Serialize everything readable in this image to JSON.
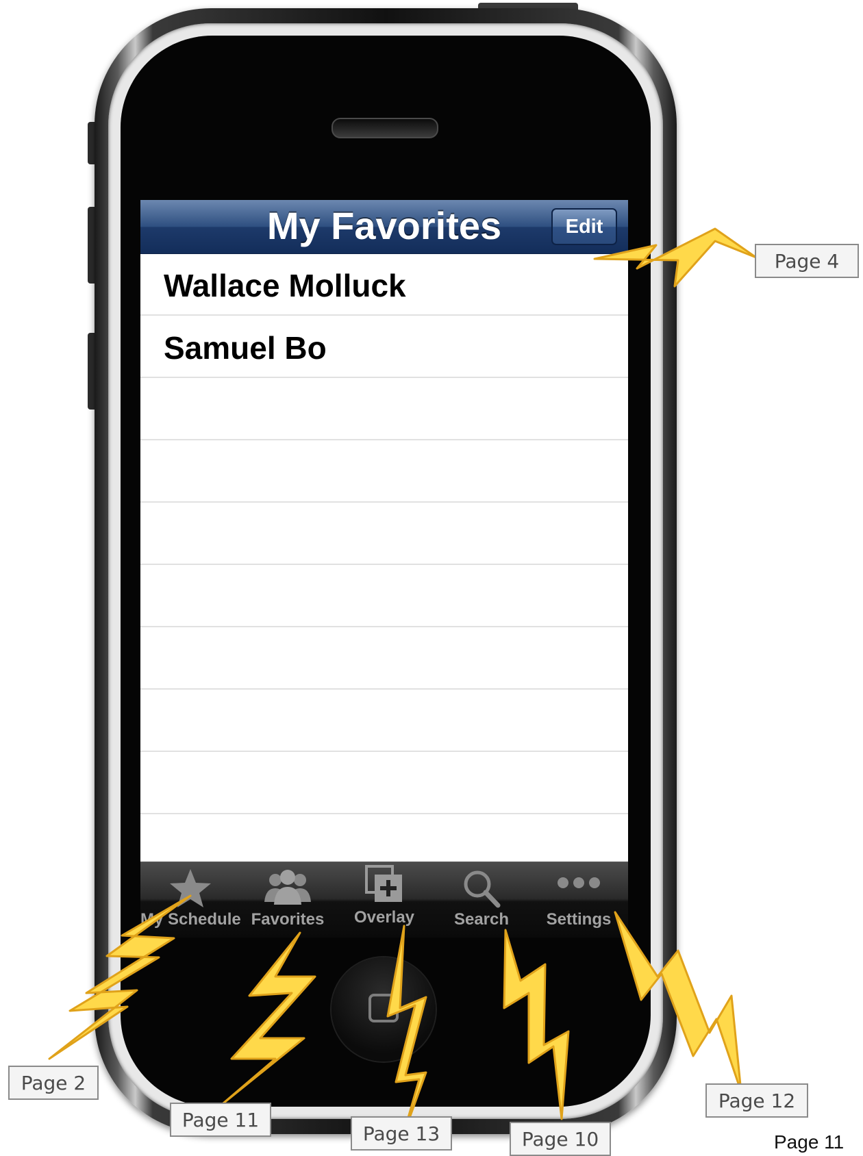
{
  "screen": {
    "title": "My Favorites",
    "edit_label": "Edit",
    "favorites": [
      "Wallace Molluck",
      "Samuel Bo"
    ]
  },
  "tab_bar": {
    "tabs": [
      {
        "label": "My Schedule",
        "icon": "star-icon"
      },
      {
        "label": "Favorites",
        "icon": "people-icon"
      },
      {
        "label": "Overlay",
        "icon": "overlay-plus-icon"
      },
      {
        "label": "Search",
        "icon": "magnifier-icon"
      },
      {
        "label": "Settings",
        "icon": "ellipsis-icon"
      }
    ]
  },
  "annotations": {
    "edit_link": "Page 4",
    "my_schedule_link": "Page 2",
    "favorites_link": "Page 11",
    "overlay_link": "Page 13",
    "search_link": "Page 10",
    "settings_link": "Page 12"
  },
  "page_number": "Page 11",
  "colors": {
    "nav_bar": "#1d3a6a",
    "tab_bar": "#111111",
    "bolt_fill": "#ffd94a",
    "bolt_stroke": "#e0a21a"
  }
}
